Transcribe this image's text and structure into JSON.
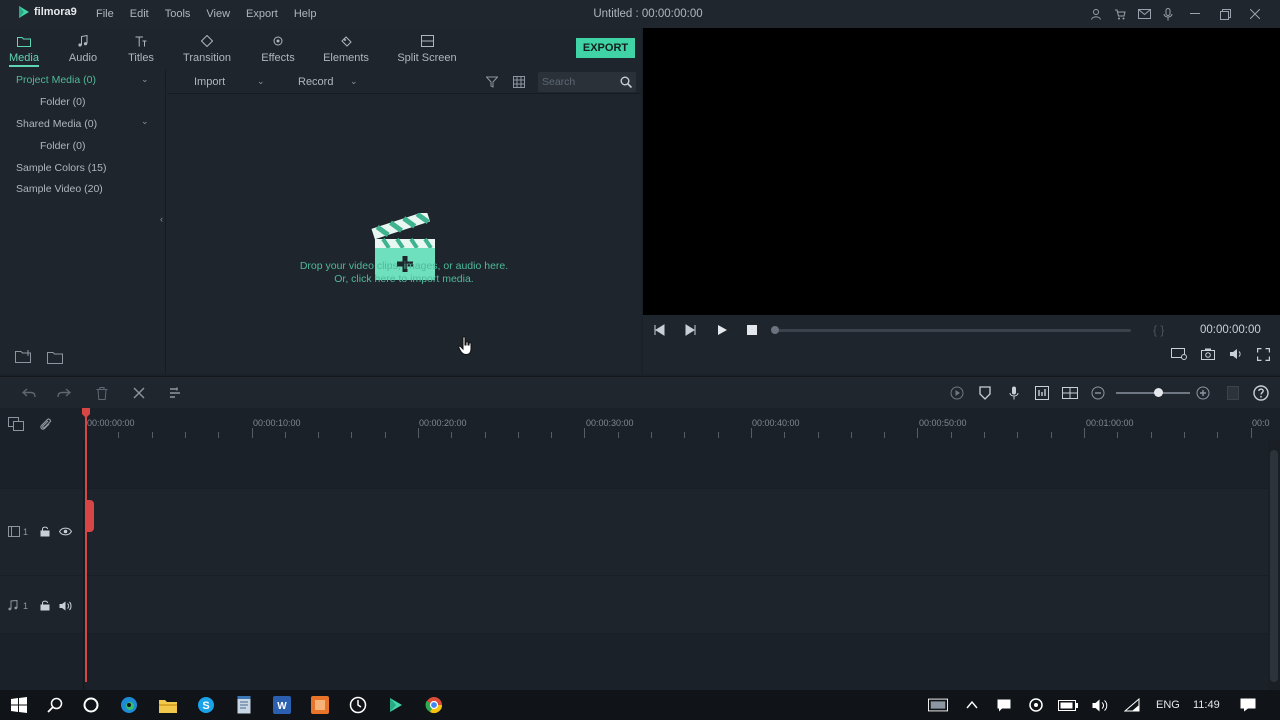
{
  "app": {
    "logo_text": "filmora9",
    "document_title": "Untitled : 00:00:00:00"
  },
  "menu": [
    "File",
    "Edit",
    "Tools",
    "View",
    "Export",
    "Help"
  ],
  "window_icons": [
    "user-icon",
    "cart-icon",
    "mail-icon",
    "microphone-icon",
    "minimize-icon",
    "restore-icon",
    "close-icon"
  ],
  "tabs": [
    {
      "label": "Media",
      "icon": "folder-icon",
      "active": true
    },
    {
      "label": "Audio",
      "icon": "music-note-icon"
    },
    {
      "label": "Titles",
      "icon": "text-icon"
    },
    {
      "label": "Transition",
      "icon": "transition-icon"
    },
    {
      "label": "Effects",
      "icon": "effects-icon"
    },
    {
      "label": "Elements",
      "icon": "elements-icon"
    },
    {
      "label": "Split Screen",
      "icon": "split-screen-icon"
    }
  ],
  "export_label": "EXPORT",
  "folder_tree": [
    {
      "label": "Project Media (0)",
      "selected": true
    },
    {
      "label": "Folder (0)"
    },
    {
      "label": "Shared Media (0)"
    },
    {
      "label": "Folder (0)"
    },
    {
      "label": "Sample Colors (15)"
    },
    {
      "label": "Sample Video (20)"
    }
  ],
  "media_toolbar": {
    "import_label": "Import",
    "record_label": "Record",
    "search_placeholder": "Search"
  },
  "drop_area": {
    "line1": "Drop your video clips, images, or audio here.",
    "line2": "Or, click here to import media."
  },
  "player": {
    "timecode": "00:00:00:00",
    "progress": 0.0
  },
  "ruler_labels": [
    "00:00:00:00",
    "00:00:10:00",
    "00:00:20:00",
    "00:00:30:00",
    "00:00:40:00",
    "00:00:50:00",
    "00:01:00:00",
    "00:0"
  ],
  "tracks": {
    "video_track_label": "1",
    "audio_track_label": "1"
  },
  "taskbar": {
    "language": "ENG",
    "time": "11:49"
  },
  "colors": {
    "accent": "#3fd3a5",
    "accent_text": "#4fb99a",
    "playhead": "#d84545",
    "preview_bg": "#000000"
  }
}
